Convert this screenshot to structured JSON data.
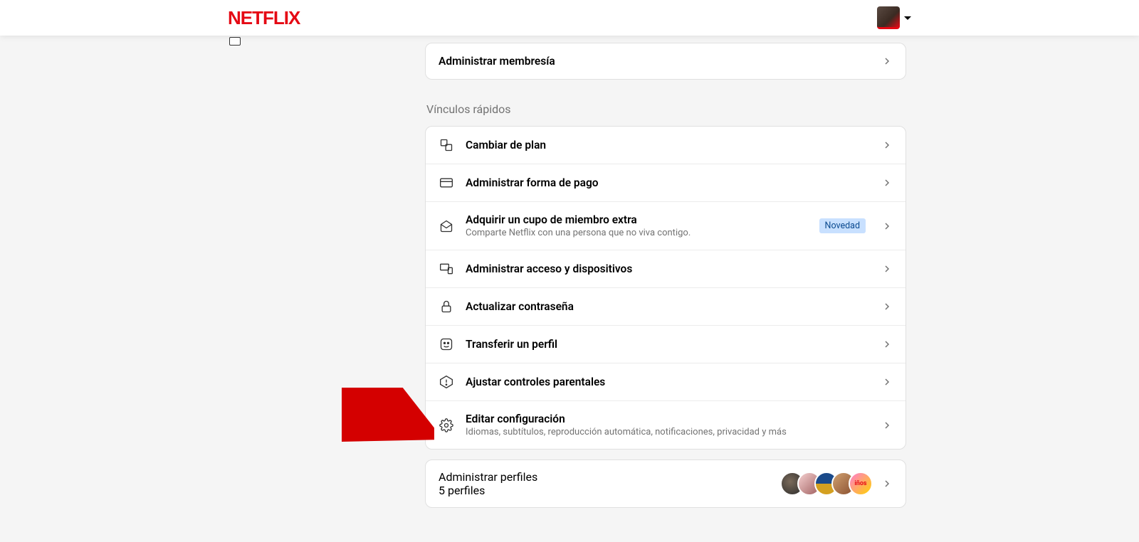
{
  "brand": "NETFLIX",
  "membership_card": {
    "title": "Administrar membresía"
  },
  "quick_links_label": "Vínculos rápidos",
  "links": [
    {
      "title": "Cambiar de plan"
    },
    {
      "title": "Administrar forma de pago"
    },
    {
      "title": "Adquirir un cupo de miembro extra",
      "subtitle": "Comparte Netflix con una persona que no viva contigo.",
      "badge": "Novedad"
    },
    {
      "title": "Administrar acceso y dispositivos"
    },
    {
      "title": "Actualizar contraseña"
    },
    {
      "title": "Transferir un perfil"
    },
    {
      "title": "Ajustar controles parentales"
    },
    {
      "title": "Editar configuración",
      "subtitle": "Idiomas, subtítulos, reproducción automática, notificaciones, privacidad y más"
    }
  ],
  "profiles": {
    "title": "Administrar perfiles",
    "subtitle": "5 perfiles",
    "kids_label": "iños"
  }
}
